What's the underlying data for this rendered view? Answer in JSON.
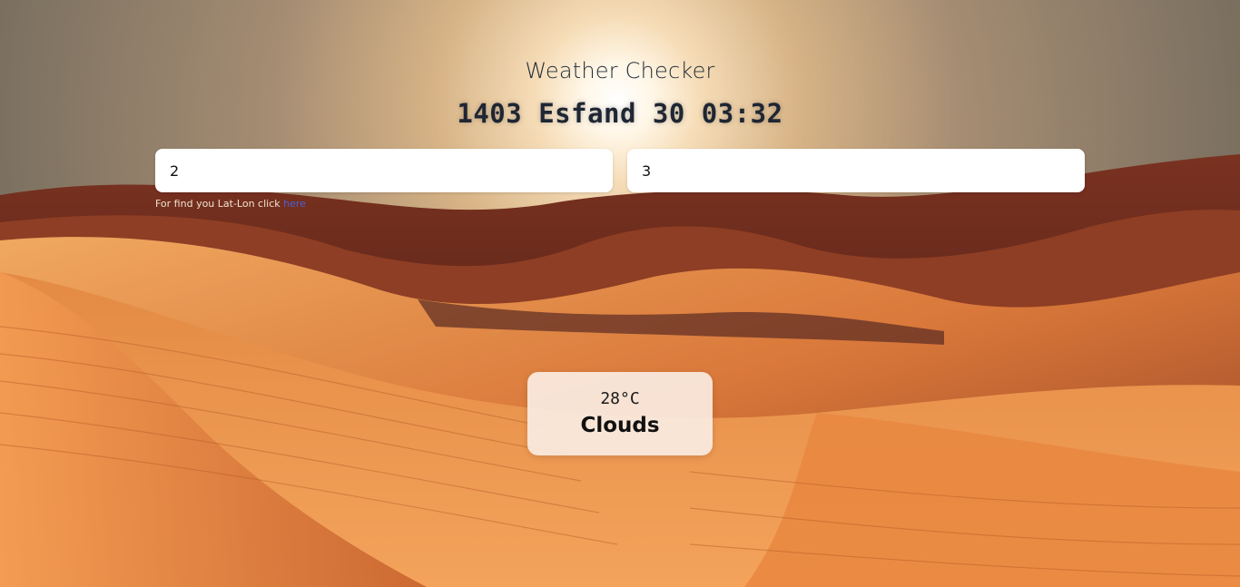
{
  "header": {
    "title": "Weather Checker",
    "datetime": "1403 Esfand 30 03:32"
  },
  "inputs": {
    "latitude_value": "2",
    "longitude_value": "3"
  },
  "hint": {
    "text": "For find you Lat-Lon click ",
    "link_label": "here"
  },
  "weather": {
    "temperature": "28°C",
    "condition": "Clouds"
  },
  "colors": {
    "link": "#4f5fd6",
    "sand": "#e38a3e",
    "shadow": "#5a2516"
  }
}
